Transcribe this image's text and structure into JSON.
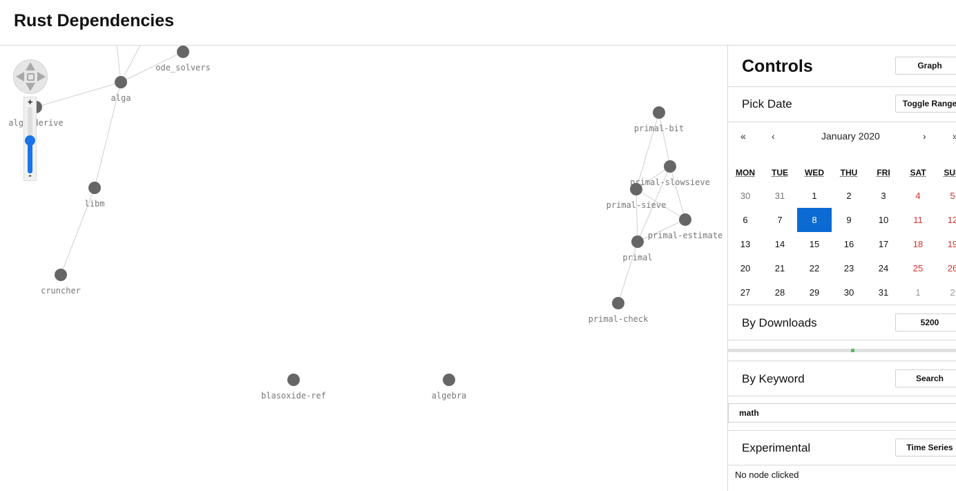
{
  "header": {
    "title": "Rust Dependencies"
  },
  "graph": {
    "nodes": [
      {
        "id": "ode_solvers",
        "label": "ode_solvers"
      },
      {
        "id": "alga",
        "label": "alga"
      },
      {
        "id": "alga_derive",
        "label": "alga_derive"
      },
      {
        "id": "libm",
        "label": "libm"
      },
      {
        "id": "cruncher",
        "label": "cruncher"
      },
      {
        "id": "primal-bit",
        "label": "primal-bit"
      },
      {
        "id": "primal-slowsieve",
        "label": "primal-slowsieve"
      },
      {
        "id": "primal-sieve",
        "label": "primal-sieve"
      },
      {
        "id": "primal-estimate",
        "label": "primal-estimate"
      },
      {
        "id": "primal",
        "label": "primal"
      },
      {
        "id": "primal-check",
        "label": "primal-check"
      },
      {
        "id": "blasoxide-ref",
        "label": "blasoxide-ref"
      },
      {
        "id": "algebra",
        "label": "algebra"
      }
    ],
    "edges": [
      [
        "alga",
        "ode_solvers"
      ],
      [
        "alga",
        "alga_derive"
      ],
      [
        "alga",
        "libm"
      ],
      [
        "libm",
        "cruncher"
      ],
      [
        "primal-bit",
        "primal-sieve"
      ],
      [
        "primal-bit",
        "primal-slowsieve"
      ],
      [
        "primal-slowsieve",
        "primal-sieve"
      ],
      [
        "primal-slowsieve",
        "primal-estimate"
      ],
      [
        "primal-slowsieve",
        "primal"
      ],
      [
        "primal-sieve",
        "primal-estimate"
      ],
      [
        "primal-sieve",
        "primal"
      ],
      [
        "primal-estimate",
        "primal"
      ],
      [
        "primal",
        "primal-check"
      ]
    ],
    "zoom_level": 0.5,
    "node_color": "#666666"
  },
  "zoom": {
    "plus": "+",
    "minus": "-"
  },
  "sidebar": {
    "controls": {
      "title": "Controls",
      "button": "Graph"
    },
    "date": {
      "title": "Pick Date",
      "button": "Toggle Range"
    },
    "calendar": {
      "prev_year": "«",
      "prev_month": "‹",
      "month_label": "January 2020",
      "next_month": "›",
      "next_year": "»",
      "weekdays": [
        "MON",
        "TUE",
        "WED",
        "THU",
        "FRI",
        "SAT",
        "SUN"
      ],
      "weeks": [
        [
          "30",
          "31",
          "1",
          "2",
          "3",
          "4",
          "5"
        ],
        [
          "6",
          "7",
          "8",
          "9",
          "10",
          "11",
          "12"
        ],
        [
          "13",
          "14",
          "15",
          "16",
          "17",
          "18",
          "19"
        ],
        [
          "20",
          "21",
          "22",
          "23",
          "24",
          "25",
          "26"
        ],
        [
          "27",
          "28",
          "29",
          "30",
          "31",
          "1",
          "2"
        ]
      ],
      "selected": "8",
      "selected_color": "#0b6bd3",
      "weekend_color": "#d0312d"
    },
    "downloads": {
      "title": "By Downloads",
      "value": "5200"
    },
    "keyword": {
      "title": "By Keyword",
      "button": "Search",
      "input_value": "math"
    },
    "experimental": {
      "title": "Experimental",
      "button": "Time Series"
    },
    "status": "No node clicked"
  }
}
